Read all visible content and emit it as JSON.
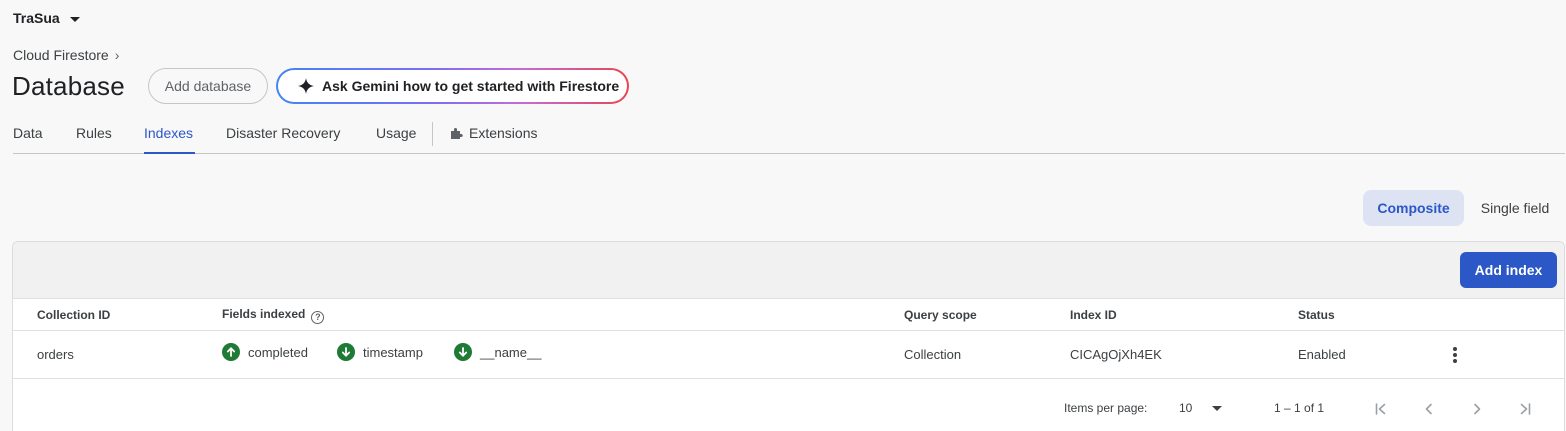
{
  "project": {
    "name": "TraSua"
  },
  "breadcrumb": {
    "label": "Cloud Firestore",
    "chevron": "›"
  },
  "page": {
    "title": "Database"
  },
  "buttons": {
    "add_database": "Add database",
    "ask_gemini": "Ask Gemini how to get started with Firestore"
  },
  "tabs": [
    {
      "label": "Data"
    },
    {
      "label": "Rules"
    },
    {
      "label": "Indexes",
      "active": true
    },
    {
      "label": "Disaster Recovery"
    },
    {
      "label": "Usage"
    },
    {
      "label": "Extensions",
      "icon": "puzzle-icon"
    }
  ],
  "segment": {
    "composite": "Composite",
    "single": "Single field",
    "selected": "Composite"
  },
  "table": {
    "add_index": "Add index",
    "headers": {
      "collection_id": "Collection ID",
      "fields_indexed": "Fields indexed",
      "help": "?",
      "query_scope": "Query scope",
      "index_id": "Index ID",
      "status": "Status"
    },
    "rows": [
      {
        "collection_id": "orders",
        "fields": [
          {
            "name": "completed",
            "direction": "ascending",
            "icon": "arrow-up-icon"
          },
          {
            "name": "timestamp",
            "direction": "descending",
            "icon": "arrow-down-icon"
          },
          {
            "name": "__name__",
            "direction": "descending",
            "icon": "arrow-down-icon"
          }
        ],
        "query_scope": "Collection",
        "index_id": "CICAgOjXh4EK",
        "status": "Enabled"
      }
    ]
  },
  "pagination": {
    "items_per_page_label": "Items per page:",
    "items_per_page": "10",
    "range": "1 – 1 of 1"
  },
  "colors": {
    "accent": "#2b57c7",
    "arrow_green": "#1e7a34",
    "segment_selected_bg": "#dde3f3"
  }
}
